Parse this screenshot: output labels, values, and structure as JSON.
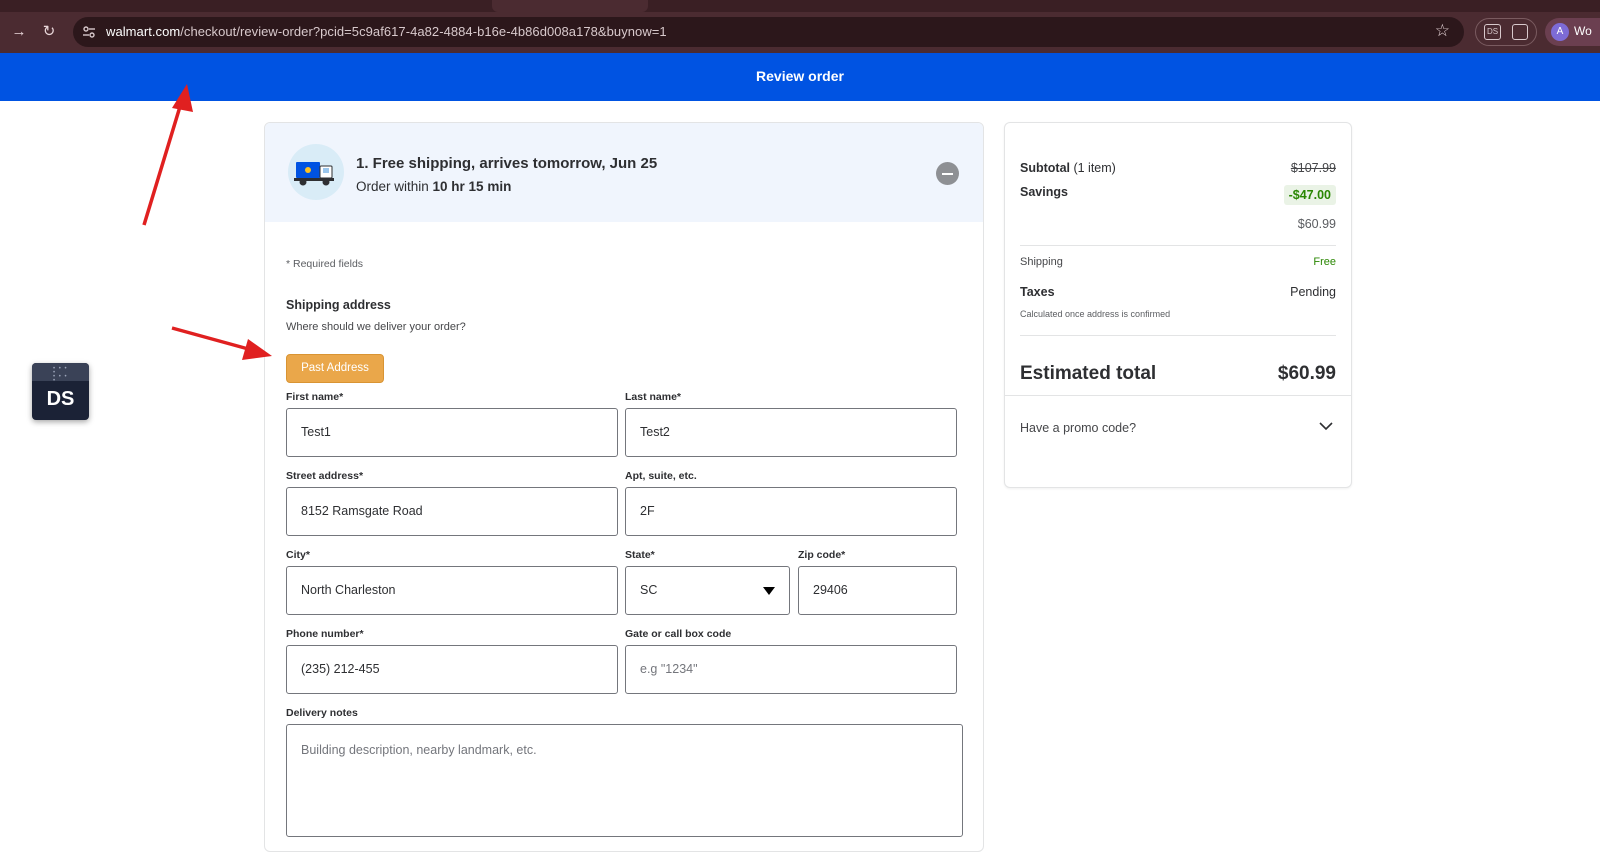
{
  "browser": {
    "url_host": "walmart.com",
    "url_path": "/checkout/review-order?pcid=5c9af617-4a82-4884-b16e-4b86d008a178&buynow=1",
    "profile_initial": "A",
    "profile_text": "Wo",
    "extension_label": "DS"
  },
  "header": {
    "title": "Review order"
  },
  "shipping_banner": {
    "title": "1. Free shipping, arrives tomorrow, Jun 25",
    "order_within_prefix": "Order within ",
    "order_within_time": "10 hr 15 min"
  },
  "form": {
    "required_note": "* Required fields",
    "section_title": "Shipping address",
    "section_subtitle": "Where should we deliver your order?",
    "past_address_label": "Past Address",
    "first_name": {
      "label": "First name*",
      "value": "Test1"
    },
    "last_name": {
      "label": "Last name*",
      "value": "Test2"
    },
    "street": {
      "label": "Street address*",
      "value": "8152 Ramsgate Road"
    },
    "apt": {
      "label": "Apt, suite, etc.",
      "value": "2F"
    },
    "city": {
      "label": "City*",
      "value": "North Charleston"
    },
    "state": {
      "label": "State*",
      "value": "SC"
    },
    "zip": {
      "label": "Zip code*",
      "value": "29406"
    },
    "phone": {
      "label": "Phone number*",
      "value": "(235) 212-455"
    },
    "gate": {
      "label": "Gate or call box code",
      "placeholder": "e.g \"1234\""
    },
    "notes": {
      "label": "Delivery notes",
      "placeholder": "Building description, nearby landmark, etc."
    }
  },
  "summary": {
    "subtotal_label": "Subtotal",
    "subtotal_items": " (1 item)",
    "subtotal_value": "$107.99",
    "savings_label": "Savings",
    "savings_value": "-$47.00",
    "after_savings": "$60.99",
    "shipping_label": "Shipping",
    "shipping_value": "Free",
    "taxes_label": "Taxes",
    "taxes_value": "Pending",
    "taxes_note": "Calculated once address is confirmed",
    "estimated_total_label": "Estimated total",
    "estimated_total_value": "$60.99",
    "promo_label": "Have a promo code?"
  },
  "widget": {
    "label": "DS"
  },
  "colors": {
    "brand_blue": "#0053e2",
    "past_address_button": "#eaa74a",
    "savings_green": "#2a8703",
    "annotation_red": "#e02020"
  }
}
